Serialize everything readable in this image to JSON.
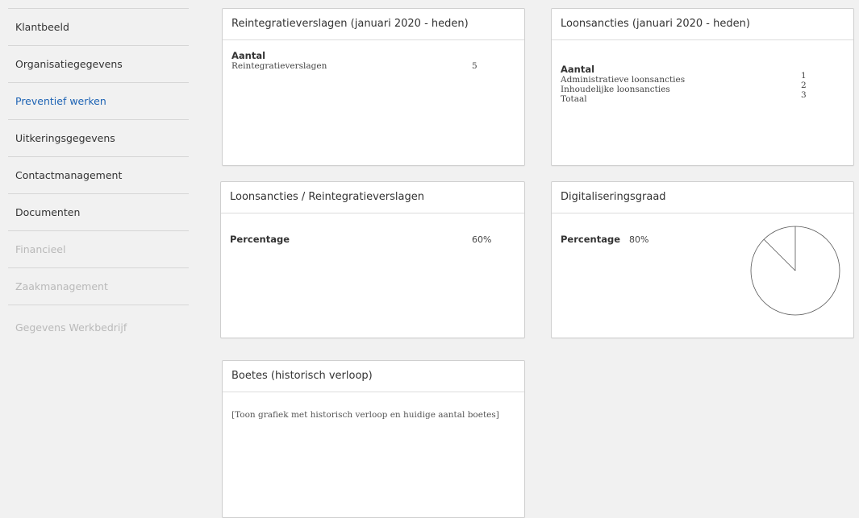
{
  "sidebar": {
    "items": [
      {
        "label": "Klantbeeld"
      },
      {
        "label": "Organisatiegegevens"
      },
      {
        "label": "Preventief werken"
      },
      {
        "label": "Uitkeringsgegevens"
      },
      {
        "label": "Contactmanagement"
      },
      {
        "label": "Documenten"
      },
      {
        "label": "Financieel"
      },
      {
        "label": "Zaakmanagement"
      },
      {
        "label": "Gegevens Werkbedrijf"
      }
    ]
  },
  "panels": {
    "reintegratie": {
      "title": "Reintegratieverslagen (januari 2020 - heden)",
      "heading": "Aantal",
      "rows": [
        {
          "label": "Reintegratieverslagen",
          "value": "5"
        }
      ]
    },
    "loonsancties": {
      "title": "Loonsancties (januari 2020 - heden)",
      "heading": "Aantal",
      "rows": [
        {
          "label": "Administratieve loonsancties",
          "value": "1"
        },
        {
          "label": "Inhoudelijke loonsancties",
          "value": "2"
        },
        {
          "label": "Totaal",
          "value": "3"
        }
      ]
    },
    "ratio": {
      "title": "Loonsancties / Reintegratieverslagen",
      "label": "Percentage",
      "value": "60%"
    },
    "digitalisering": {
      "title": "Digitaliseringsgraad",
      "label": "Percentage",
      "value": "80%",
      "pie_fraction": 0.875
    },
    "boetes": {
      "title": "Boetes (historisch verloop)",
      "placeholder": "[Toon grafiek met historisch verloop en huidige aantal boetes]"
    }
  }
}
